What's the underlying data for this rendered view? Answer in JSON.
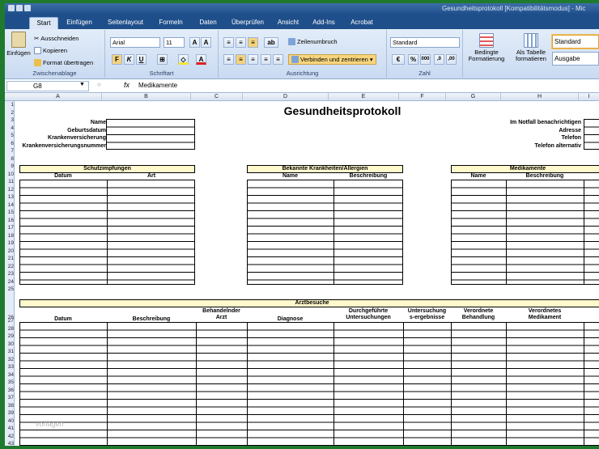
{
  "window": {
    "title": "Gesundheitsprotokoll [Kompatibilitätsmodus] - Mic"
  },
  "tabs": [
    "Start",
    "Einfügen",
    "Seitenlayout",
    "Formeln",
    "Daten",
    "Überprüfen",
    "Ansicht",
    "Add-Ins",
    "Acrobat"
  ],
  "ribbon": {
    "paste": "Einfügen",
    "cut": "Ausschneiden",
    "copy": "Kopieren",
    "format_painter": "Format übertragen",
    "font": "Arial",
    "size": "11",
    "grow": "A",
    "shrink": "A",
    "bold": "F",
    "italic": "K",
    "underline": "U",
    "border": "⊞",
    "fill": "◇",
    "font_color": "A",
    "lines": "≡",
    "orient": "ab",
    "wrap": "Zeilenumbruch",
    "merge": "Verbinden und zentrieren",
    "number_format": "Standard",
    "currency": "€",
    "percent": "%",
    "thousand": "000",
    "dec_up": ",0",
    "dec_down": ",00",
    "cond": "Bedingte Formatierung",
    "astable": "Als Tabelle formatieren",
    "style1": "Standard",
    "style2": "Ausgabe",
    "groups": [
      "Zwischenablage",
      "Schriftart",
      "Ausrichtung",
      "Zahl"
    ]
  },
  "formula": {
    "cell": "G8",
    "fx": "fx",
    "value": "Medikamente"
  },
  "columns": [
    "A",
    "B",
    "C",
    "D",
    "E",
    "F",
    "G",
    "H",
    "I"
  ],
  "rows": [
    "1",
    "2",
    "3",
    "4",
    "5",
    "6",
    "7",
    "8",
    "9",
    "10",
    "11",
    "12",
    "13",
    "14",
    "15",
    "16",
    "17",
    "18",
    "19",
    "20",
    "21",
    "22",
    "23",
    "24",
    "25",
    "26",
    "27",
    "28",
    "29",
    "30",
    "31",
    "32",
    "33",
    "34",
    "35",
    "36",
    "37",
    "38",
    "39",
    "40",
    "41",
    "42",
    "43"
  ],
  "sheet": {
    "title": "Gesundheitsprotokoll",
    "left_labels": [
      "Name",
      "Geburtsdatum",
      "Krankenversicherung",
      "Krankenversicherungsnummer"
    ],
    "right_labels": [
      "Im Notfall benachrichtigen",
      "Adresse",
      "Telefon",
      "Telefon alternativ"
    ],
    "vaccinations": {
      "title": "Schutzimpfungen",
      "cols": [
        "Datum",
        "Art"
      ]
    },
    "diseases": {
      "title": "Bekannte Krankheiten/Allergien",
      "cols": [
        "Name",
        "Beschreibung"
      ]
    },
    "medications": {
      "title": "Medikamente",
      "cols": [
        "Name",
        "Beschreibung"
      ]
    },
    "visits": {
      "title": "Arztbesuche",
      "cols": [
        "Datum",
        "Beschreibung",
        "Behandelnder\nArzt",
        "Diagnose",
        "Durchgeführte\nUntersuchungen",
        "Untersuchung\ns-ergebnisse",
        "Verordnete\nBehandlung",
        "Verordnetes\nMedikament"
      ]
    },
    "watermark": "vorlagen"
  }
}
